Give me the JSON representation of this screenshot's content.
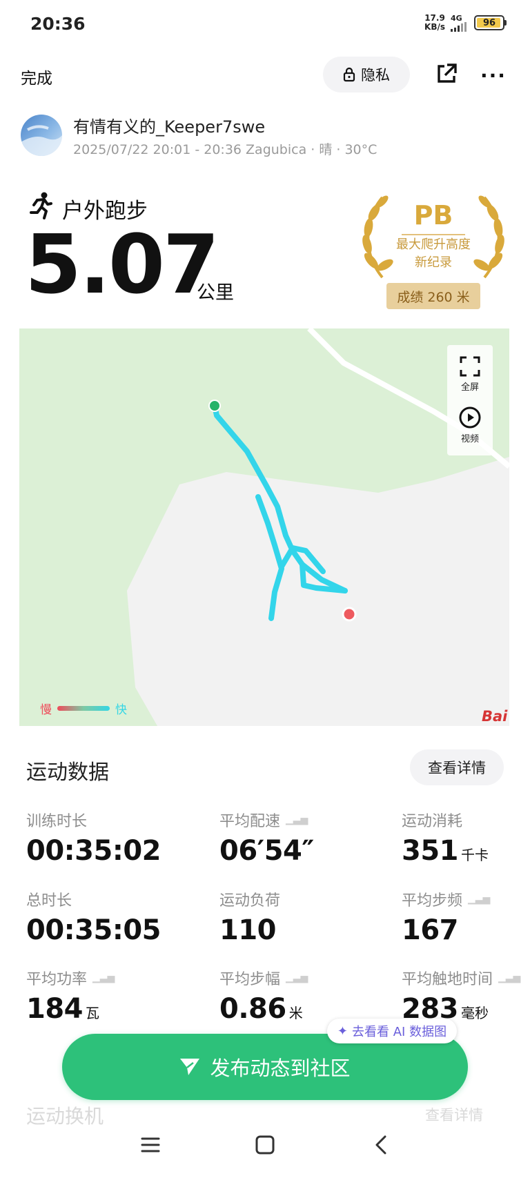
{
  "status_bar": {
    "time": "20:36",
    "net_speed_value": "17.9",
    "net_speed_unit": "KB/s",
    "network": "4G",
    "battery": "96"
  },
  "toolbar": {
    "done_label": "完成",
    "privacy_label": "隐私",
    "share_icon": "share-icon",
    "more_icon": "more-icon"
  },
  "user": {
    "name": "有情有义的_Keeper7swe",
    "meta": "2025/07/22 20:01 - 20:36 Zagubica · 晴 · 30°C"
  },
  "activity": {
    "type": "户外跑步",
    "distance": "5.07",
    "distance_unit": "公里"
  },
  "pb_badge": {
    "title": "PB",
    "line1": "最大爬升高度",
    "line2": "新纪录",
    "result": "成绩 260 米",
    "color": "#d9a93b"
  },
  "map": {
    "fullscreen_label": "全屏",
    "video_label": "视频",
    "legend_slow": "慢",
    "legend_fast": "快",
    "provider_logo": "Bai",
    "route_color": "#33d5ea",
    "start_color": "#27b36a",
    "end_color": "#ee5a5f"
  },
  "stats": {
    "title": "运动数据",
    "details_label": "查看详情",
    "items": [
      {
        "label": "训练时长",
        "value": "00:35:02",
        "unit": "",
        "trend": false
      },
      {
        "label": "平均配速",
        "value": "06′54″",
        "unit": "",
        "trend": true
      },
      {
        "label": "运动消耗",
        "value": "351",
        "unit": "千卡",
        "trend": false
      },
      {
        "label": "总时长",
        "value": "00:35:05",
        "unit": "",
        "trend": false
      },
      {
        "label": "运动负荷",
        "value": "110",
        "unit": "",
        "trend": false
      },
      {
        "label": "平均步频",
        "value": "167",
        "unit": "",
        "trend": true
      },
      {
        "label": "平均功率",
        "value": "184",
        "unit": "瓦",
        "trend": true
      },
      {
        "label": "平均步幅",
        "value": "0.86",
        "unit": "米",
        "trend": true
      },
      {
        "label": "平均触地时间",
        "value": "283",
        "unit": "毫秒",
        "trend": true
      }
    ]
  },
  "ai_pill": {
    "label": "去看看 AI 数据图"
  },
  "post_button": {
    "label": "发布动态到社区",
    "color": "#2dc17a"
  },
  "next_section": {
    "title": "运动换机",
    "details_label": "查看详情"
  }
}
